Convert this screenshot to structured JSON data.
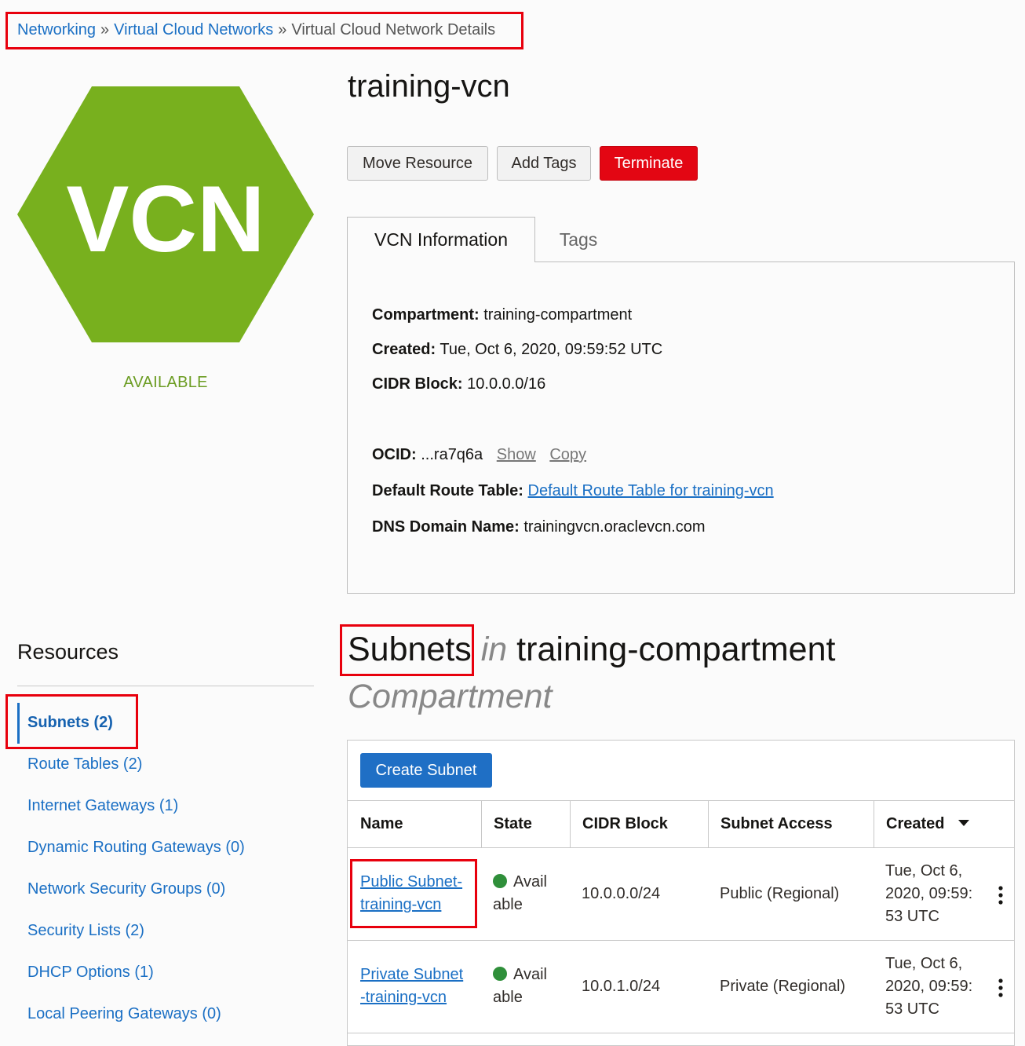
{
  "breadcrumb": {
    "items": [
      {
        "label": "Networking"
      },
      {
        "label": "Virtual Cloud Networks"
      }
    ],
    "separator": "»",
    "current": "Virtual Cloud Network Details"
  },
  "resource": {
    "logo_text": "VCN",
    "logo_color": "#78b01e",
    "status": "AVAILABLE",
    "title": "training-vcn"
  },
  "actions": {
    "move": "Move Resource",
    "add_tags": "Add Tags",
    "terminate": "Terminate"
  },
  "tabs": [
    {
      "label": "VCN Information",
      "active": true
    },
    {
      "label": "Tags",
      "active": false
    }
  ],
  "info": {
    "compartment_label": "Compartment:",
    "compartment": "training-compartment",
    "created_label": "Created:",
    "created": "Tue, Oct 6, 2020, 09:59:52 UTC",
    "cidr_label": "CIDR Block:",
    "cidr": "10.0.0.0/16",
    "ocid_label": "OCID:",
    "ocid": "...ra7q6a",
    "show": "Show",
    "copy": "Copy",
    "route_label": "Default Route Table:",
    "route": "Default Route Table for training-vcn",
    "dns_label": "DNS Domain Name:",
    "dns": "trainingvcn.oraclevcn.com"
  },
  "resources": {
    "title": "Resources",
    "items": [
      {
        "label": "Subnets (2)",
        "active": true
      },
      {
        "label": "Route Tables (2)"
      },
      {
        "label": "Internet Gateways (1)"
      },
      {
        "label": "Dynamic Routing Gateways (0)"
      },
      {
        "label": "Network Security Groups (0)"
      },
      {
        "label": "Security Lists (2)"
      },
      {
        "label": "DHCP Options (1)"
      },
      {
        "label": "Local Peering Gateways (0)"
      }
    ]
  },
  "subnets": {
    "heading": "Subnets",
    "in": "in",
    "compartment": "training-compartment",
    "compartment_word": "Compartment",
    "create_button": "Create Subnet",
    "columns": [
      "Name",
      "State",
      "CIDR Block",
      "Subnet Access",
      "Created"
    ],
    "rows": [
      {
        "name_line1": "Public Subnet-",
        "name_line2": "training-vcn",
        "state_line1": "Avail",
        "state_line2": "able",
        "cidr": "10.0.0.0/24",
        "access": "Public (Regional)",
        "created_line1": "Tue, Oct 6,",
        "created_line2": "2020, 09:59:",
        "created_line3": "53 UTC"
      },
      {
        "name_line1": "Private Subnet",
        "name_line2": "-training-vcn",
        "state_line1": "Avail",
        "state_line2": "able",
        "cidr": "10.0.1.0/24",
        "access": "Private (Regional)",
        "created_line1": "Tue, Oct 6,",
        "created_line2": "2020, 09:59:",
        "created_line3": "53 UTC"
      }
    ]
  },
  "colors": {
    "link": "#1a6fc4",
    "terminate": "#e30613",
    "highlight_box": "#e8000d",
    "status_available": "#6b9c22",
    "state_dot": "#2f8f3a"
  }
}
